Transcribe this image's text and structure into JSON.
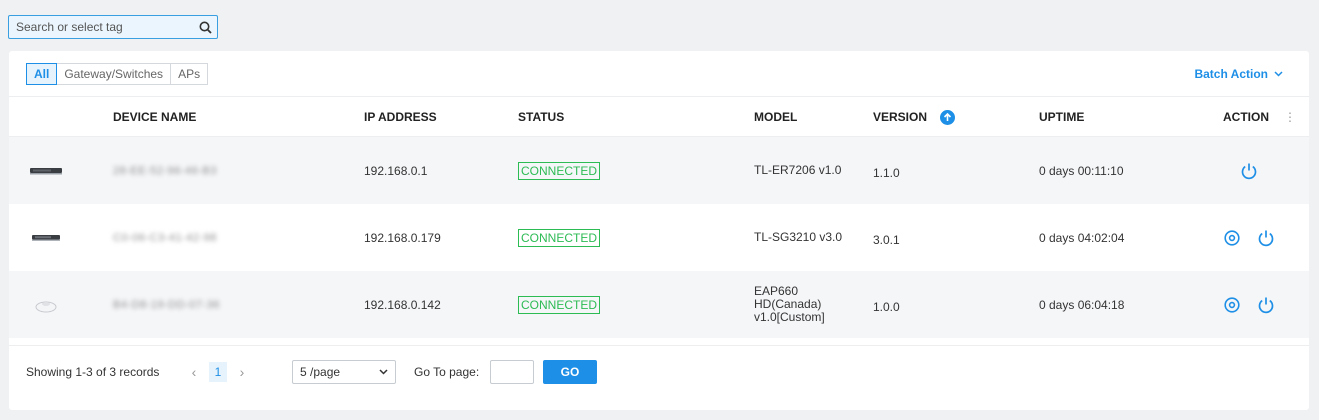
{
  "search": {
    "placeholder": "Search or select tag"
  },
  "filter_tabs": [
    {
      "label": "All",
      "active": true
    },
    {
      "label": "Gateway/Switches",
      "active": false
    },
    {
      "label": "APs",
      "active": false
    }
  ],
  "batch_action": "Batch Action",
  "table": {
    "headers": {
      "device_name": "DEVICE NAME",
      "ip_address": "IP ADDRESS",
      "status": "STATUS",
      "model": "MODEL",
      "version": "VERSION",
      "uptime": "UPTIME",
      "action": "ACTION"
    },
    "rows": [
      {
        "device_name": "28-EE-52-96-46-B3",
        "ip": "192.168.0.1",
        "status": "CONNECTED",
        "model": "TL-ER7206 v1.0",
        "version": "1.1.0",
        "uptime": "0 days 00:11:10",
        "image": "router-icon"
      },
      {
        "device_name": "C0-06-C3-41-42-98",
        "ip": "192.168.0.179",
        "status": "CONNECTED",
        "model": "TL-SG3210 v3.0",
        "version": "3.0.1",
        "uptime": "0 days 04:02:04",
        "image": "switch-icon"
      },
      {
        "device_name": "B4-D8-19-DD-07-36",
        "ip": "192.168.0.142",
        "status": "CONNECTED",
        "model": "EAP660 HD(Canada) v1.0[Custom]",
        "model_lines": [
          "EAP660",
          "HD(Canada)",
          "v1.0[Custom]"
        ],
        "version": "1.0.0",
        "uptime": "0 days 06:04:18",
        "image": "access-point-icon"
      }
    ]
  },
  "footer": {
    "records_text": "Showing 1-3 of 3 records",
    "current_page": "1",
    "page_size": "5 /page",
    "goto_label": "Go To page:",
    "goto_value": "",
    "go_button": "GO"
  },
  "colors": {
    "accent": "#1e8fe6",
    "status_green": "#2dbb54"
  }
}
